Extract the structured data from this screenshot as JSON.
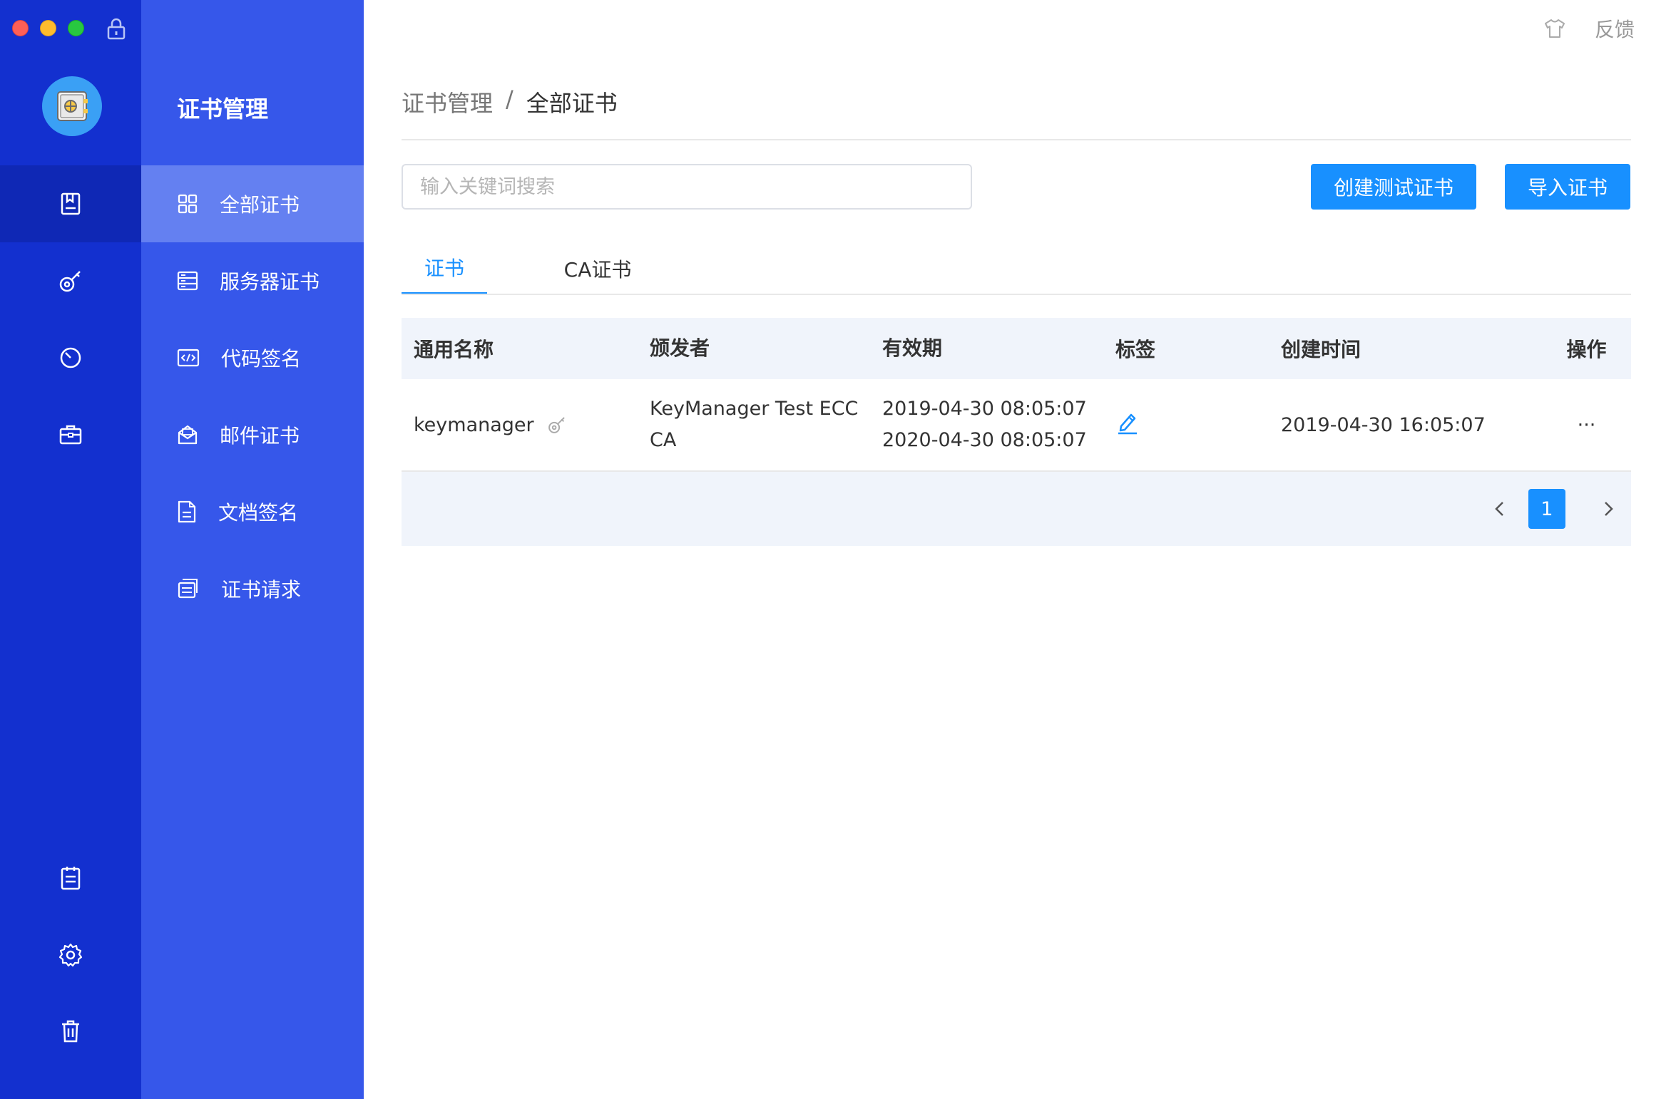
{
  "window": {
    "title": "证书管理"
  },
  "rail": {
    "items": [
      {
        "name": "certificates",
        "icon": "certificate-icon",
        "active": true
      },
      {
        "name": "keys",
        "icon": "key-icon"
      },
      {
        "name": "timer",
        "icon": "clock-icon"
      },
      {
        "name": "toolbox",
        "icon": "briefcase-icon"
      },
      {
        "name": "logs",
        "icon": "clipboard-icon"
      },
      {
        "name": "settings",
        "icon": "gear-icon"
      },
      {
        "name": "trash",
        "icon": "trash-icon"
      }
    ]
  },
  "submenu": {
    "title": "证书管理",
    "items": [
      {
        "label": "全部证书",
        "icon": "grid-icon",
        "active": true
      },
      {
        "label": "服务器证书",
        "icon": "server-icon"
      },
      {
        "label": "代码签名",
        "icon": "code-icon"
      },
      {
        "label": "邮件证书",
        "icon": "mail-icon"
      },
      {
        "label": "文档签名",
        "icon": "document-icon"
      },
      {
        "label": "证书请求",
        "icon": "request-icon"
      }
    ]
  },
  "topbar": {
    "feedback": "反馈"
  },
  "breadcrumb": {
    "parent": "证书管理",
    "separator": "/",
    "current": "全部证书"
  },
  "search": {
    "placeholder": "输入关键词搜索",
    "value": ""
  },
  "buttons": {
    "create": "创建测试证书",
    "import": "导入证书"
  },
  "tabs": [
    {
      "label": "证书",
      "active": true
    },
    {
      "label": "CA证书",
      "active": false
    }
  ],
  "table": {
    "headers": [
      "通用名称",
      "颁发者",
      "有效期",
      "标签",
      "创建时间",
      "操作"
    ],
    "rows": [
      {
        "name": "keymanager",
        "issuer_line1": "KeyManager Test ECC",
        "issuer_line2": "CA",
        "valid_from": "2019-04-30 08:05:07",
        "valid_to": "2020-04-30 08:05:07",
        "created": "2019-04-30 16:05:07",
        "actions": "···"
      }
    ]
  },
  "pagination": {
    "current_page": "1"
  },
  "colors": {
    "rail": "#1330cf",
    "submenu": "#3657ea",
    "accent": "#1890ff"
  }
}
